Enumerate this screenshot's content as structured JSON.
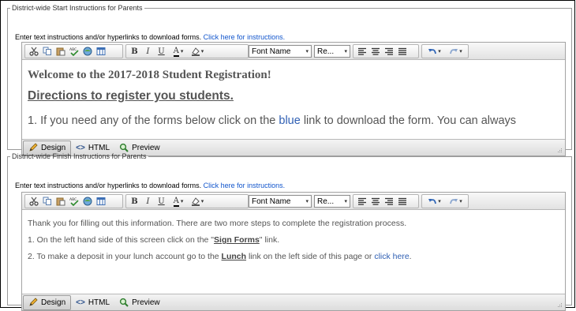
{
  "start_panel": {
    "legend": "District-wide Start Instructions for Parents",
    "instruction_text": "Enter text instructions and/or hyperlinks to download forms.",
    "instruction_link": "Click here for instructions.",
    "editor": {
      "font_select": "Font Name",
      "size_select": "Re...",
      "content": {
        "heading": "Welcome to the 2017-2018 Student Registration!",
        "subheading": "Directions to register you students.",
        "line1_pre": "1. If you need any of the forms below click on the ",
        "line1_link": "blue",
        "line1_post": " link to download the form.  You can always"
      }
    }
  },
  "finish_panel": {
    "legend": "District-wide Finish Instructions for Parents",
    "instruction_text": "Enter text instructions and/or hyperlinks to download forms.",
    "instruction_link": "Click here for instructions.",
    "editor": {
      "font_select": "Font Name",
      "size_select": "Re...",
      "content": {
        "line1": "Thank you for filling out this information.  There are two more steps to complete the registration process.",
        "line2_pre": "1. On the left hand side of this screen click on the \"",
        "line2_bold": "Sign Forms",
        "line2_post": "\" link.",
        "line3_pre": "2. To make a deposit in your lunch account go to the ",
        "line3_bold": "Lunch",
        "line3_mid": " link on the left side of this page or ",
        "line3_link": "click here",
        "line3_post": "."
      }
    }
  },
  "toolbar": {
    "bold": "B",
    "italic": "I",
    "underline": "U",
    "font_color": "A"
  },
  "modes": {
    "design": "Design",
    "html": "HTML",
    "preview": "Preview"
  }
}
